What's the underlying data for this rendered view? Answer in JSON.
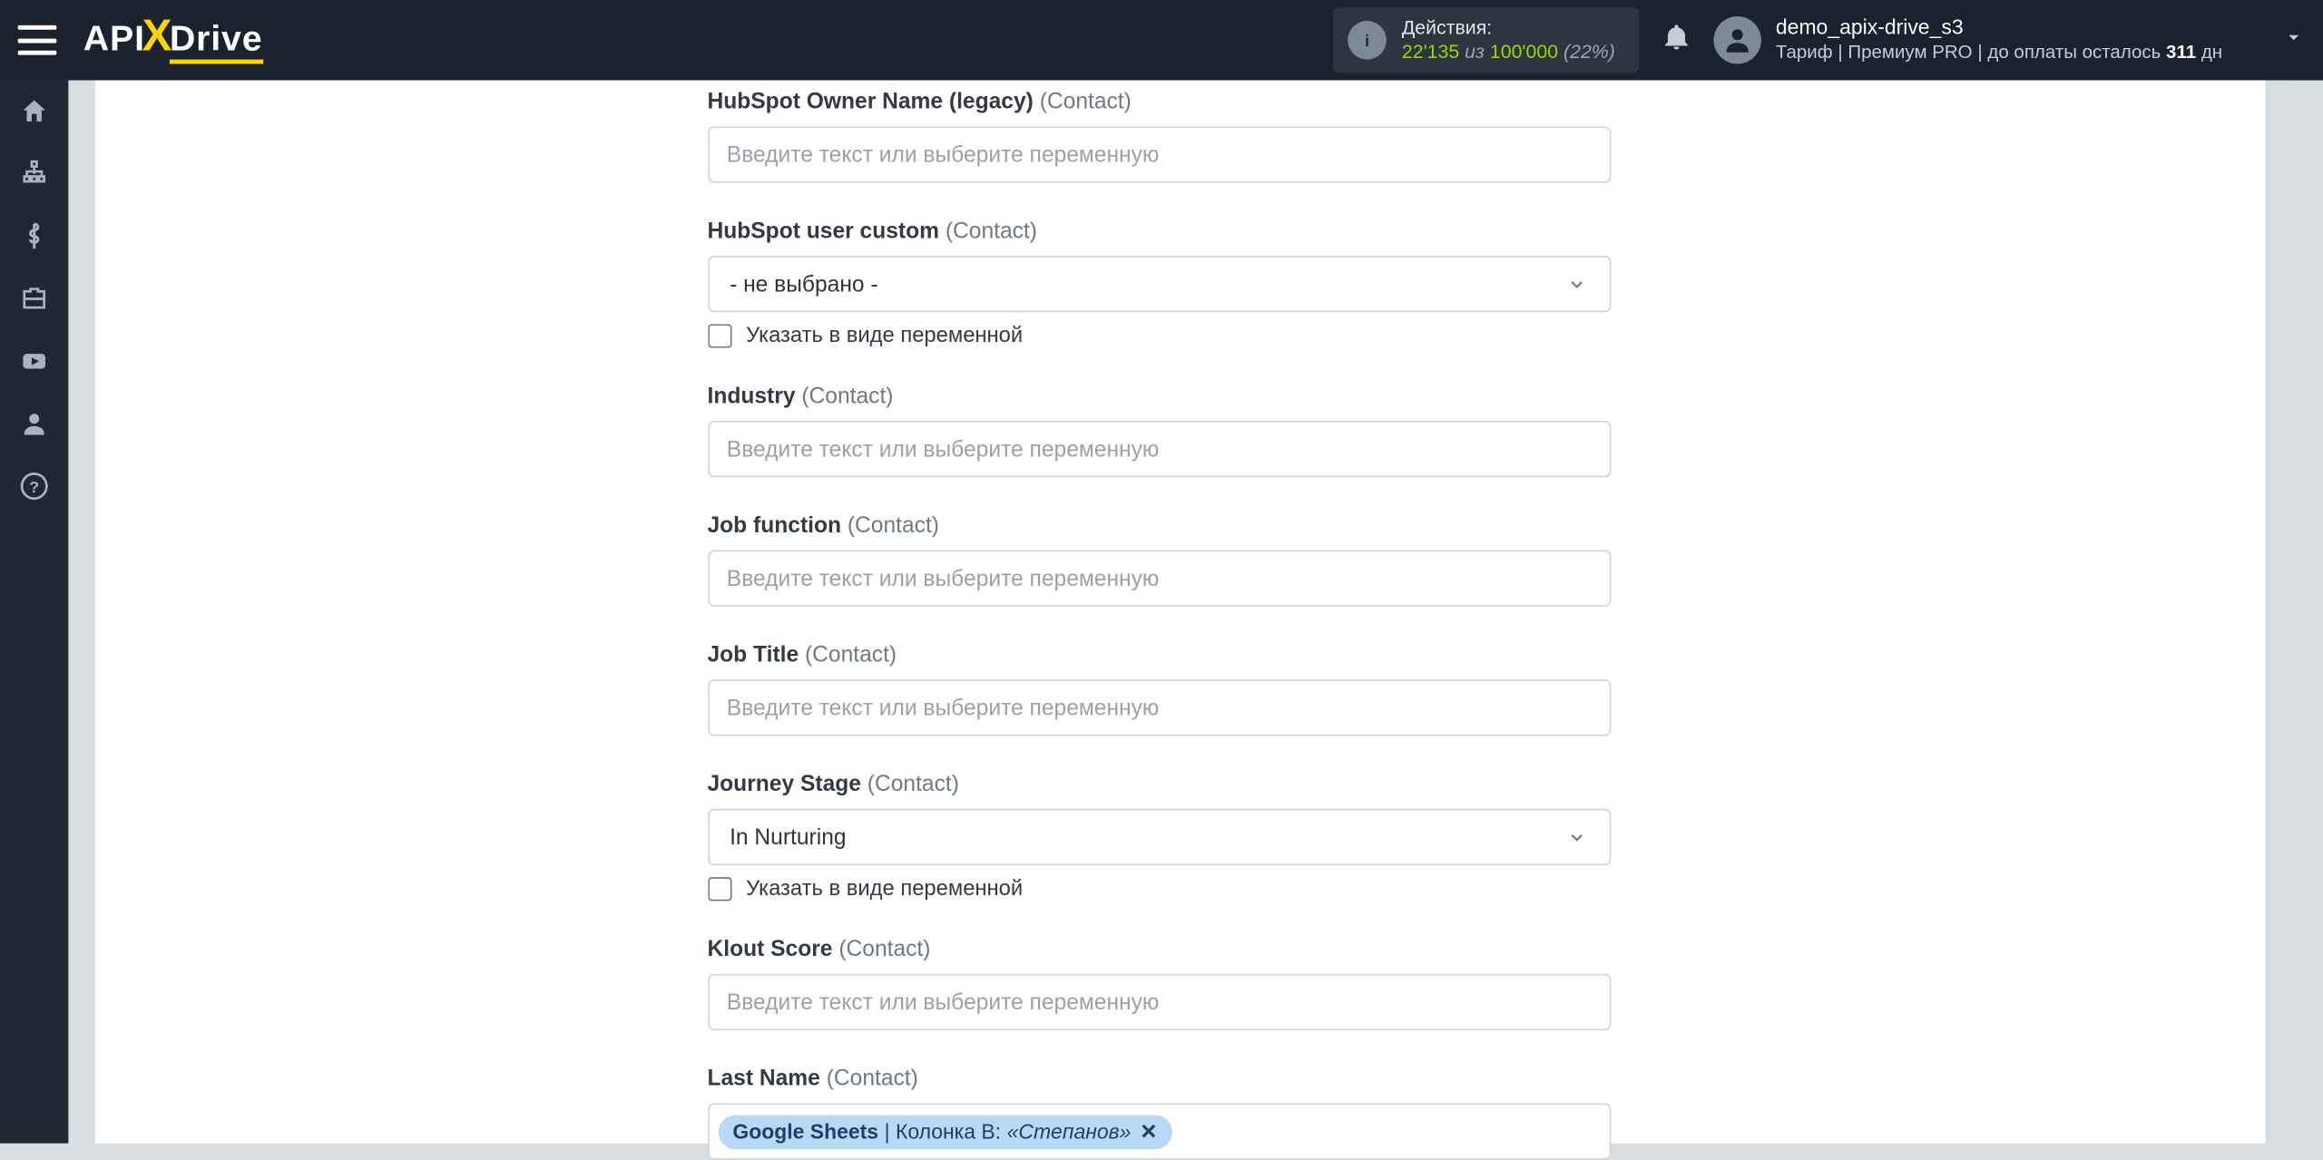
{
  "header": {
    "logo_pre": "API",
    "logo_post": "Drive",
    "actions": {
      "title": "Действия:",
      "used": "22'135",
      "sep": "из",
      "total": "100'000",
      "pct": "(22%)"
    },
    "user": {
      "name": "demo_apix-drive_s3",
      "tariff_label": "Тариф",
      "tariff_name": "Премиум PRO",
      "pay_prefix": "до оплаты осталось",
      "days": "311",
      "days_unit": "дн"
    }
  },
  "placeholders": {
    "text": "Введите текст или выберите переменную",
    "none": "- не выбрано -"
  },
  "checkbox_label": "Указать в виде переменной",
  "fields": [
    {
      "key": "owner",
      "label": "HubSpot Owner Name (legacy)",
      "sub": "(Contact)",
      "type": "input"
    },
    {
      "key": "usercustom",
      "label": "HubSpot user custom",
      "sub": "(Contact)",
      "type": "select",
      "value": "- не выбрано -",
      "checkbox": true
    },
    {
      "key": "industry",
      "label": "Industry",
      "sub": "(Contact)",
      "type": "input"
    },
    {
      "key": "jobfunc",
      "label": "Job function",
      "sub": "(Contact)",
      "type": "input"
    },
    {
      "key": "jobtitle",
      "label": "Job Title",
      "sub": "(Contact)",
      "type": "input"
    },
    {
      "key": "journey",
      "label": "Journey Stage",
      "sub": "(Contact)",
      "type": "select",
      "value": "In Nurturing",
      "checkbox": true
    },
    {
      "key": "klout",
      "label": "Klout Score",
      "sub": "(Contact)",
      "type": "input"
    },
    {
      "key": "lastname",
      "label": "Last Name",
      "sub": "(Contact)",
      "type": "tag",
      "tag": {
        "source": "Google Sheets",
        "mid": " | Колонка B: ",
        "value": "«Степанов»"
      }
    }
  ]
}
